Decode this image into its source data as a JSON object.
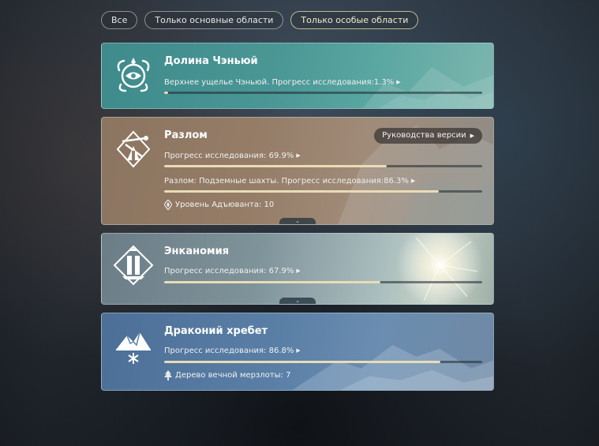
{
  "filters": [
    {
      "label": "Все",
      "active": false
    },
    {
      "label": "Только основные области",
      "active": false
    },
    {
      "label": "Только особые области",
      "active": true
    }
  ],
  "regions": [
    {
      "name": "Долина Чэньюй",
      "emblem": "chenyu-vale-emblem-icon",
      "rows": [
        {
          "text": "Верхнее ущелье Чэньюй. Прогресс исследования:1.3%",
          "progress": 1.3
        }
      ]
    },
    {
      "name": "Разлом",
      "emblem": "chasm-emblem-icon",
      "version_button": "Руководства версии",
      "rows": [
        {
          "text": "Прогресс исследования: 69.9%",
          "progress": 69.9
        },
        {
          "text": "Разлом: Подземные шахты. Прогресс исследования:86.3%",
          "progress": 86.3
        }
      ],
      "meta": {
        "icon": "reputation-icon",
        "text": "Уровень Адъюванта: 10"
      }
    },
    {
      "name": "Энканомия",
      "emblem": "enkanomiya-emblem-icon",
      "rows": [
        {
          "text": "Прогресс исследования: 67.9%",
          "progress": 67.9
        }
      ]
    },
    {
      "name": "Драконий хребет",
      "emblem": "dragonspine-emblem-icon",
      "rows": [
        {
          "text": "Прогресс исследования: 86.8%",
          "progress": 86.8
        }
      ],
      "meta": {
        "icon": "frostbearing-tree-icon",
        "text": "Дерево вечной мерзлоты: 7"
      }
    }
  ],
  "colors": {
    "progress_fill": "#e9dcb6",
    "card_chenyu": "#4a9796",
    "card_chasm": "#957d68",
    "card_enkanomiya": "#7f939b",
    "card_dragonspine": "#5a7fa6"
  }
}
